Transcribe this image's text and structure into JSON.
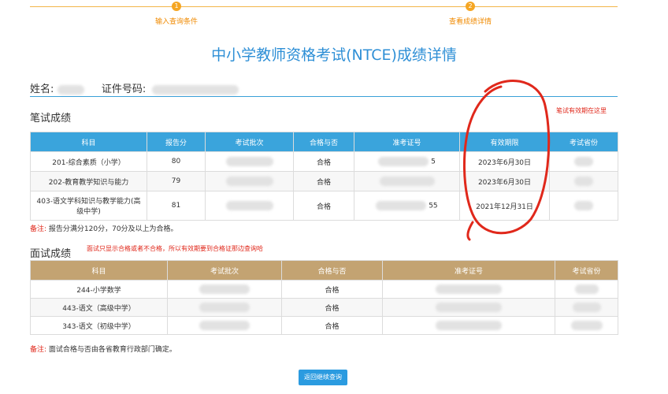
{
  "steps": [
    {
      "num": "1",
      "label": "输入查询条件"
    },
    {
      "num": "2",
      "label": "查看成绩详情"
    }
  ],
  "title": "中小学教师资格考试(NTCE)成绩详情",
  "info": {
    "name_label": "姓名:",
    "id_label": "证件号码:"
  },
  "written": {
    "section_title": "笔试成绩",
    "annotation": "笔试有效期在这里",
    "headers": [
      "科目",
      "报告分",
      "考试批次",
      "合格与否",
      "准考证号",
      "有效期限",
      "考试省份"
    ],
    "rows": [
      {
        "subject": "201-综合素质（小学）",
        "score": "80",
        "result": "合格",
        "id_tail": "5",
        "validity": "2023年6月30日"
      },
      {
        "subject": "202-教育教学知识与能力",
        "score": "79",
        "result": "合格",
        "id_tail": "",
        "validity": "2023年6月30日"
      },
      {
        "subject": "403-语文学科知识与教学能力(高级中学)",
        "score": "81",
        "result": "合格",
        "id_tail": "55",
        "validity": "2021年12月31日"
      }
    ],
    "note_label": "备注:",
    "note_text": "报告分满分120分，70分及以上为合格。"
  },
  "interview": {
    "section_title": "面试成绩",
    "annotation": "面试只显示合格或者不合格，所以有效期要到合格证那边查询哈",
    "headers": [
      "科目",
      "考试批次",
      "合格与否",
      "准考证号",
      "考试省份"
    ],
    "rows": [
      {
        "subject": "244-小学数学",
        "result": "合格"
      },
      {
        "subject": "443-语文（高级中学）",
        "result": "合格"
      },
      {
        "subject": "343-语文（初级中学）",
        "result": "合格"
      }
    ],
    "note_label": "备注:",
    "note_text": "面试合格与否由各省教育行政部门确定。"
  },
  "back_button": "返回继续查询",
  "colors": {
    "accent_blue": "#2e8fd6",
    "table_blue": "#3aa4dc",
    "table_tan": "#c3a372",
    "annotation_red": "#e0281b",
    "step_orange": "#f5a623"
  }
}
